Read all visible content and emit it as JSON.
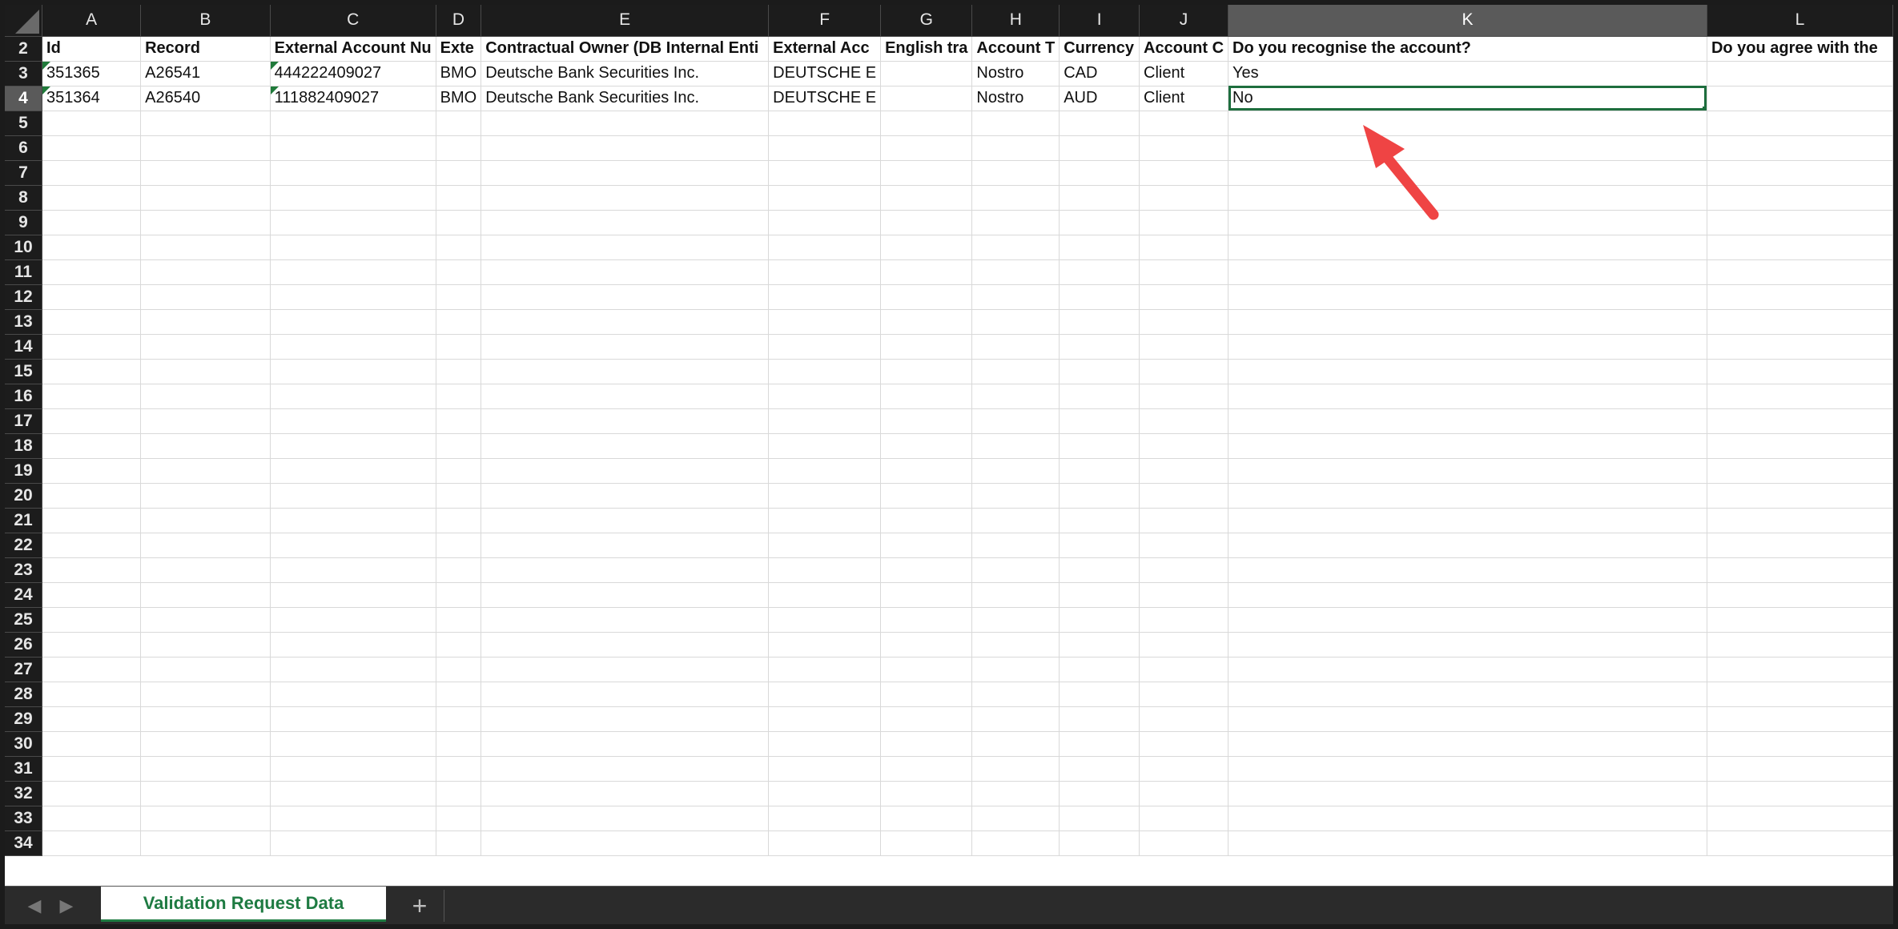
{
  "columns": [
    "A",
    "B",
    "C",
    "D",
    "E",
    "F",
    "G",
    "H",
    "I",
    "J",
    "K",
    "L"
  ],
  "selected_column": "K",
  "rows": [
    {
      "num": "2",
      "cells": [
        "Id",
        "Record",
        "External Account Nu",
        "Exte",
        "Contractual Owner (DB Internal Enti",
        "External Acc",
        "English tra",
        "Account T",
        "Currency",
        "Account C",
        "Do you recognise the account?",
        "Do you agree with the"
      ]
    },
    {
      "num": "3",
      "cells": [
        "351365",
        "A26541",
        "444222409027",
        "BMO",
        "Deutsche Bank Securities Inc.",
        "DEUTSCHE E",
        "",
        "Nostro",
        "CAD",
        "Client",
        "Yes",
        ""
      ]
    },
    {
      "num": "4",
      "cells": [
        "351364",
        "A26540",
        "111882409027",
        "BMO",
        "Deutsche Bank Securities Inc.",
        "DEUTSCHE E",
        "",
        "Nostro",
        "AUD",
        "Client",
        "No",
        ""
      ]
    }
  ],
  "empty_rows": [
    "5",
    "6",
    "7",
    "8",
    "9",
    "10",
    "11",
    "12",
    "13",
    "14",
    "15",
    "16",
    "17",
    "18",
    "19",
    "20",
    "21",
    "22",
    "23",
    "24",
    "25",
    "26",
    "27",
    "28",
    "29",
    "30",
    "31",
    "32",
    "33",
    "34"
  ],
  "selected_row": "4",
  "tabbar": {
    "prev_icon": "◀",
    "next_icon": "▶",
    "active_tab": "Validation Request Data",
    "add_icon": "+"
  },
  "colors": {
    "accent": "#1e7b42",
    "arrow": "#ef4444"
  }
}
